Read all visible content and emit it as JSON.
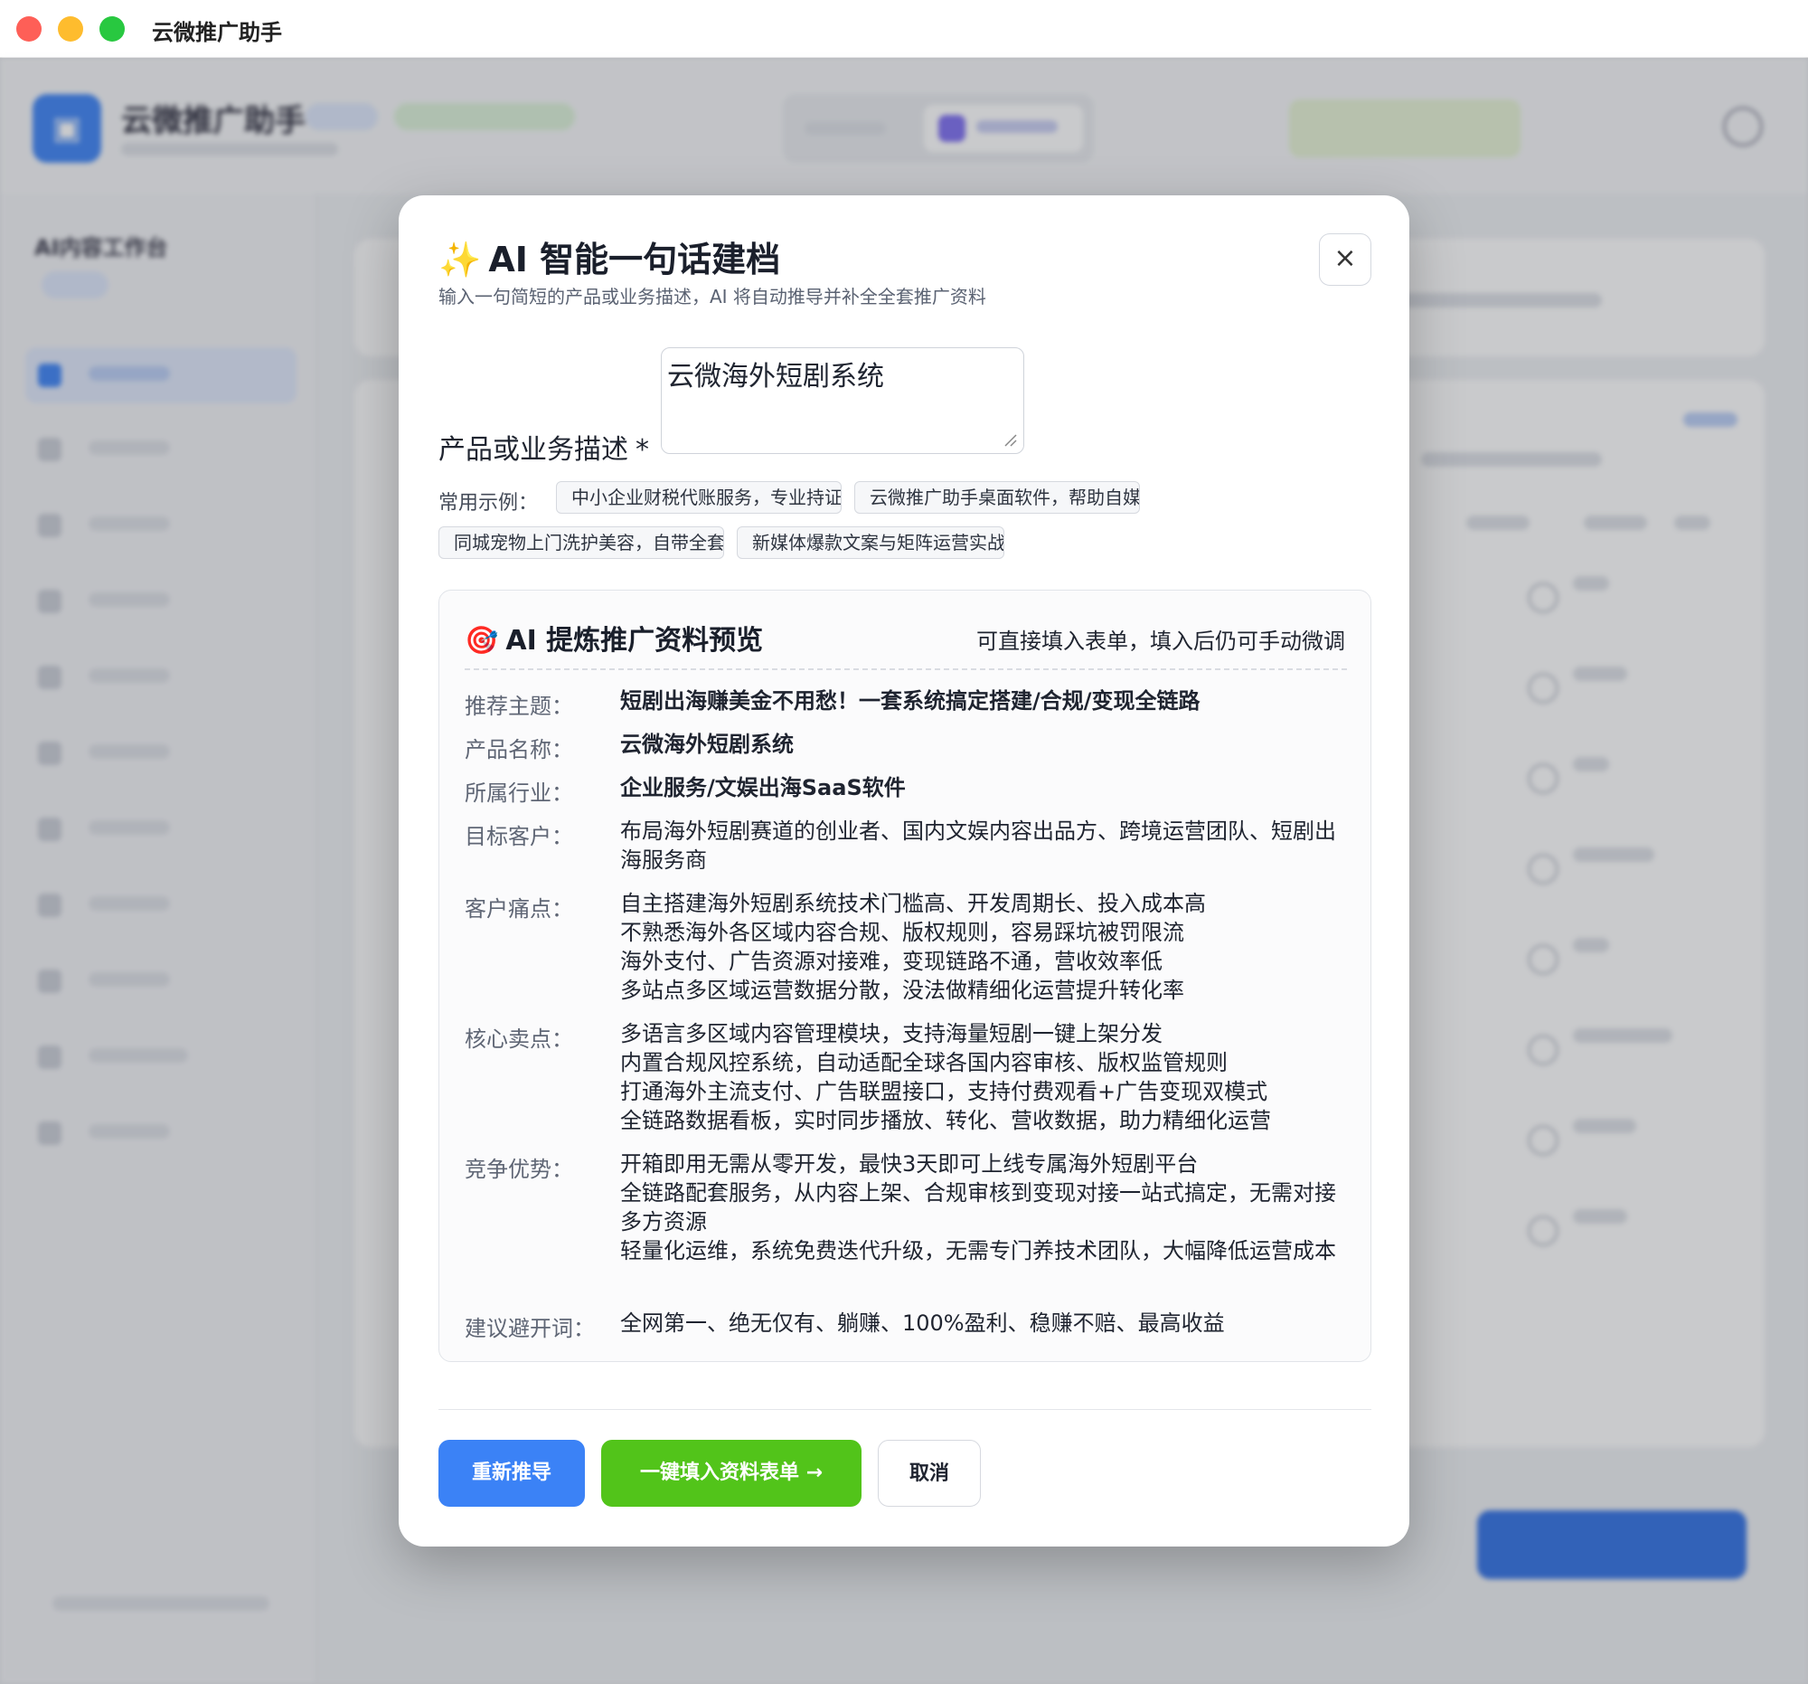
{
  "window": {
    "title": "云微推广助手"
  },
  "background": {
    "app_title": "云微推广助手",
    "sidebar_title": "AI内容工作台"
  },
  "modal": {
    "icon": "sparkles-icon",
    "title": "AI 智能一句话建档",
    "subtitle": "输入一句简短的产品或业务描述，AI 将自动推导并补全全套推广资料",
    "close_label": "×",
    "field_label": "产品或业务描述",
    "required_mark": "*",
    "description_value": "云微海外短剧系统",
    "examples_label": "常用示例：",
    "examples": [
      "中小企业财税代账服务，专业持证会...",
      "云微推广助手桌面软件，帮助自媒体...",
      "同城宠物上门洗护美容，自带全套紫...",
      "新媒体爆款文案与矩阵运营实战课，..."
    ],
    "preview": {
      "icon": "target-icon",
      "title": "AI 提炼推广资料预览",
      "hint": "可直接填入表单，填入后仍可手动微调",
      "rows": [
        {
          "label": "推荐主题：",
          "lines": [
            "短剧出海赚美金不用愁！一套系统搞定搭建/合规/变现全链路"
          ]
        },
        {
          "label": "产品名称：",
          "lines": [
            "云微海外短剧系统"
          ]
        },
        {
          "label": "所属行业：",
          "lines": [
            "企业服务/文娱出海SaaS软件"
          ]
        },
        {
          "label": "目标客户：",
          "lines": [
            "布局海外短剧赛道的创业者、国内文娱内容出品方、跨境运营团队、短剧出海服务商"
          ]
        },
        {
          "label": "客户痛点：",
          "lines": [
            "自主搭建海外短剧系统技术门槛高、开发周期长、投入成本高",
            "不熟悉海外各区域内容合规、版权规则，容易踩坑被罚限流",
            "海外支付、广告资源对接难，变现链路不通，营收效率低",
            "多站点多区域运营数据分散，没法做精细化运营提升转化率"
          ]
        },
        {
          "label": "核心卖点：",
          "lines": [
            "多语言多区域内容管理模块，支持海量短剧一键上架分发",
            "内置合规风控系统，自动适配全球各国内容审核、版权监管规则",
            "打通海外主流支付、广告联盟接口，支持付费观看+广告变现双模式",
            "全链路数据看板，实时同步播放、转化、营收数据，助力精细化运营"
          ]
        },
        {
          "label": "竞争优势：",
          "lines": [
            "开箱即用无需从零开发，最快3天即可上线专属海外短剧平台",
            "全链路配套服务，从内容上架、合规审核到变现对接一站式搞定，无需对接多方资源",
            "轻量化运维，系统免费迭代升级，无需专门养技术团队，大幅降低运营成本"
          ]
        },
        {
          "label": "建议避开词：",
          "lines": [
            "全网第一、绝无仅有、躺赚、100%盈利、稳赚不赔、最高收益"
          ]
        }
      ]
    },
    "buttons": {
      "regenerate": "重新推导",
      "fill_form": "一键填入资料表单 →",
      "cancel": "取消"
    }
  }
}
